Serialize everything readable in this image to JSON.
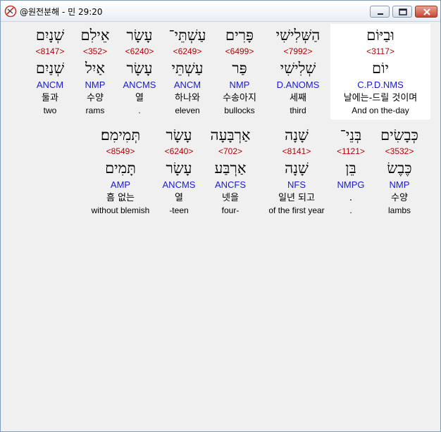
{
  "window": {
    "title": "@원전분해 - 민 29:20"
  },
  "rows": [
    {
      "words": [
        {
          "hebrew": "וּבַיּוֹם",
          "strong": "<3117>",
          "lemma": "יוֹם",
          "parse": "C.P.D.NMS",
          "korean": "날에는-드릴 것이며",
          "english": "And on the-day",
          "selected": true
        },
        {
          "hebrew": "הַשְּׁלִישִׁי",
          "strong": "<7992>",
          "lemma": "שְׁלִישִׁי",
          "parse": "D.ANOMS",
          "korean": "세째",
          "english": "third"
        },
        {
          "hebrew": "פָּרִים",
          "strong": "<6499>",
          "lemma": "פַּר",
          "parse": "NMP",
          "korean": "수송아지",
          "english": "bullocks"
        },
        {
          "hebrew": "עַשְׁתֵּי־",
          "strong": "<6249>",
          "lemma": "עַשְׁתֵּי",
          "parse": "ANCM",
          "korean": "하나와",
          "english": "eleven"
        },
        {
          "hebrew": "עָשָׂר",
          "strong": "<6240>",
          "lemma": "עָשָׂר",
          "parse": "ANCMS",
          "korean": "열",
          "english": "."
        },
        {
          "hebrew": "אֵילִם",
          "strong": "<352>",
          "lemma": "אַיִל",
          "parse": "NMP",
          "korean": "수양",
          "english": "rams"
        },
        {
          "hebrew": "שְׁנָיִם",
          "strong": "<8147>",
          "lemma": "שְׁנַיִם",
          "parse": "ANCM",
          "korean": "둘과",
          "english": "two"
        }
      ]
    },
    {
      "words": [
        {
          "hebrew": "כְּבָשִׂים",
          "strong": "<3532>",
          "lemma": "כֶּבֶשׂ",
          "parse": "NMP",
          "korean": "수양",
          "english": "lambs"
        },
        {
          "hebrew": "בְּנֵי־",
          "strong": "<1121>",
          "lemma": "בֵּן",
          "parse": "NMPG",
          "korean": ".",
          "english": "."
        },
        {
          "hebrew": "שָׁנָה",
          "strong": "<8141>",
          "lemma": "שָׁנָה",
          "parse": "NFS",
          "korean": "일년 되고",
          "english": "of the first year"
        },
        {
          "hebrew": "אַרְבָּעָה",
          "strong": "<702>",
          "lemma": "אַרְבַּע",
          "parse": "ANCFS",
          "korean": "넷을",
          "english": "four-"
        },
        {
          "hebrew": "עָשָׂר",
          "strong": "<6240>",
          "lemma": "עָשָׂר",
          "parse": "ANCMS",
          "korean": "열",
          "english": "-teen"
        },
        {
          "hebrew": "תְּמִימִם׃",
          "strong": "<8549>",
          "lemma": "תָּמִים",
          "parse": "AMP",
          "korean": "흠 없는",
          "english": "without blemish"
        }
      ]
    }
  ]
}
